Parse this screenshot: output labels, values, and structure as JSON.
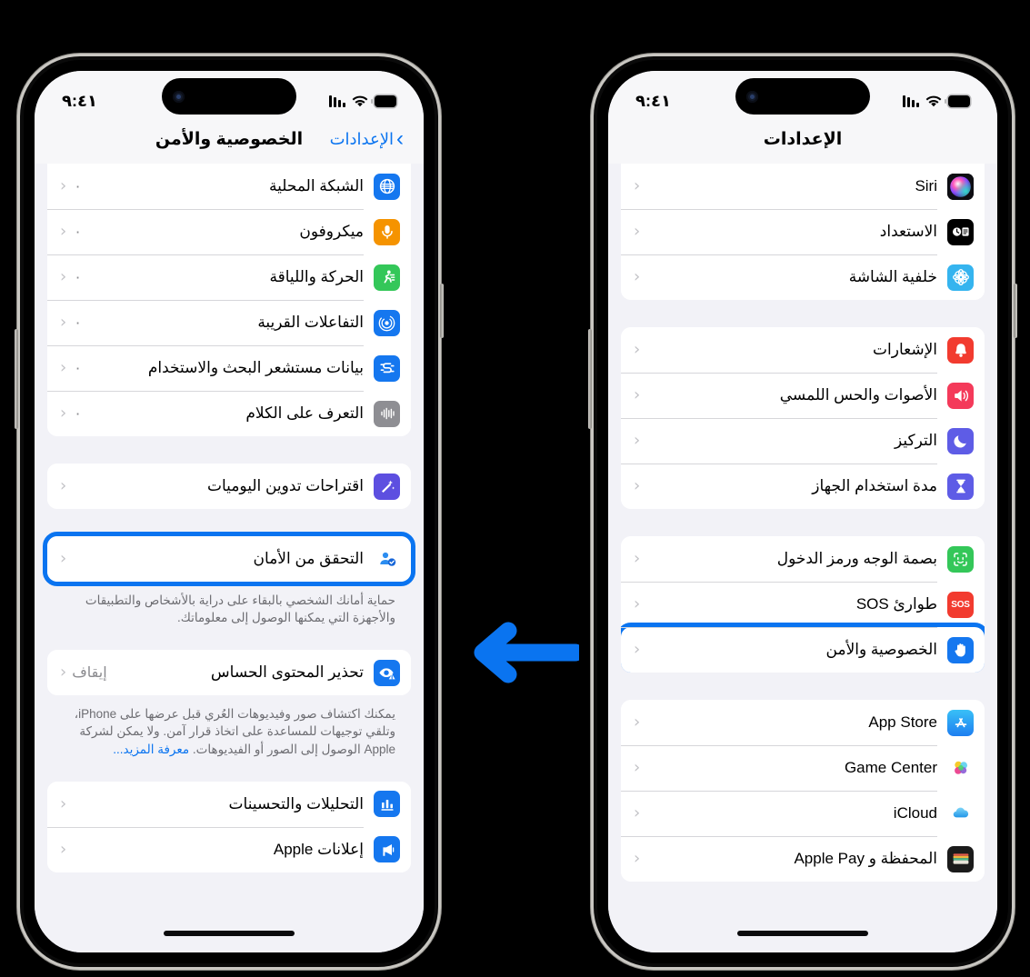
{
  "meta": {
    "background_color": "#000000",
    "accent_color": "#0a74f0",
    "highlight_color": "#0a74f0"
  },
  "arrow": {
    "name": "left-pointing-arrow",
    "color": "#0a74f0",
    "direction": "left"
  },
  "phones": [
    {
      "id": "left",
      "status_bar": {
        "time": "٩:٤١",
        "icons": [
          "battery-icon",
          "wifi-icon",
          "cellular-signal-icon"
        ]
      },
      "nav": {
        "back_label": "الإعدادات",
        "title": "الخصوصية والأمن",
        "back_icon": "chevron-right-icon"
      },
      "sections": [
        {
          "id": "permissions",
          "flush_top": true,
          "rows": [
            {
              "label": "الشبكة المحلية",
              "icon": "globe-icon",
              "icon_color": "#1577ef",
              "value": "٠",
              "chevron": true
            },
            {
              "label": "ميكروفون",
              "icon": "microphone-icon",
              "icon_color": "#f59300",
              "value": "٠",
              "chevron": true
            },
            {
              "label": "الحركة واللياقة",
              "icon": "motion-fitness-icon",
              "icon_color": "#34c759",
              "value": "٠",
              "chevron": true
            },
            {
              "label": "التفاعلات القريبة",
              "icon": "nearby-interactions-icon",
              "icon_color": "#1577ef",
              "value": "٠",
              "chevron": true
            },
            {
              "label": "بيانات مستشعر البحث والاستخدام",
              "icon": "research-sensor-icon",
              "icon_color": "#1577ef",
              "value": "٠",
              "chevron": true
            },
            {
              "label": "التعرف على الكلام",
              "icon": "speech-recognition-icon",
              "icon_color": "#8e8e93",
              "value": "٠",
              "chevron": true
            }
          ]
        },
        {
          "id": "journaling",
          "rows": [
            {
              "label": "اقتراحات تدوين اليوميات",
              "icon": "journaling-suggestions-icon",
              "icon_color": "#5d4fe0",
              "chevron": true
            }
          ]
        },
        {
          "id": "safety-check",
          "highlighted": true,
          "rows": [
            {
              "label": "التحقق من الأمان",
              "icon": "safety-check-icon",
              "icon_color": "#ffffff",
              "chevron": true
            }
          ],
          "footnote": "حماية أمانك الشخصي بالبقاء على دراية بالأشخاص والتطبيقات والأجهزة التي يمكنها الوصول إلى معلوماتك."
        },
        {
          "id": "sensitive-content",
          "rows": [
            {
              "label": "تحذير المحتوى الحساس",
              "icon": "sensitive-content-icon",
              "icon_color": "#1577ef",
              "value": "إيقاف",
              "chevron": true
            }
          ],
          "footnote": "يمكنك اكتشاف صور وفيديوهات العُري قبل عرضها على iPhone، وتلقي توجيهات للمساعدة على اتخاذ قرار آمن. ولا يمكن لشركة Apple الوصول إلى الصور أو الفيديوهات.",
          "footnote_link": "معرفة المزيد..."
        },
        {
          "id": "analytics",
          "rows": [
            {
              "label": "التحليلات والتحسينات",
              "icon": "analytics-icon",
              "icon_color": "#1577ef",
              "chevron": true
            },
            {
              "label": "إعلانات Apple",
              "icon": "apple-advertising-icon",
              "icon_color": "#1577ef",
              "chevron": true
            }
          ]
        }
      ]
    },
    {
      "id": "right",
      "status_bar": {
        "time": "٩:٤١",
        "icons": [
          "battery-icon",
          "wifi-icon",
          "cellular-signal-icon"
        ]
      },
      "nav": {
        "back_label": "",
        "title": "الإعدادات",
        "back_icon": ""
      },
      "sections": [
        {
          "id": "siri-group",
          "flush_top": true,
          "rows": [
            {
              "label": "Siri",
              "icon": "siri-icon",
              "icon_color": "#111111",
              "chevron": true
            },
            {
              "label": "الاستعداد",
              "icon": "standby-icon",
              "icon_color": "#000000",
              "chevron": true
            },
            {
              "label": "خلفية الشاشة",
              "icon": "wallpaper-icon",
              "icon_color": "#35b4ef",
              "chevron": true
            }
          ]
        },
        {
          "id": "notifications-group",
          "rows": [
            {
              "label": "الإشعارات",
              "icon": "notifications-bell-icon",
              "icon_color": "#f23b2f",
              "chevron": true
            },
            {
              "label": "الأصوات والحس اللمسي",
              "icon": "sounds-haptics-icon",
              "icon_color": "#f43a5a",
              "chevron": true
            },
            {
              "label": "التركيز",
              "icon": "focus-moon-icon",
              "icon_color": "#5e5ce6",
              "chevron": true
            },
            {
              "label": "مدة استخدام الجهاز",
              "icon": "screen-time-hourglass-icon",
              "icon_color": "#5e5ce6",
              "chevron": true
            }
          ]
        },
        {
          "id": "security-group",
          "rows": [
            {
              "label": "بصمة الوجه ورمز الدخول",
              "icon": "face-id-icon",
              "icon_color": "#34c759",
              "chevron": true
            },
            {
              "label": "طوارئ SOS",
              "icon": "sos-icon",
              "icon_color": "#f23b2f",
              "chevron": true
            },
            {
              "label": "الخصوصية والأمن",
              "icon": "privacy-hand-icon",
              "icon_color": "#1577ef",
              "chevron": true,
              "highlighted": true
            }
          ]
        },
        {
          "id": "services-group",
          "rows": [
            {
              "label": "App Store",
              "icon": "app-store-icon",
              "icon_color": "#2aa3f5",
              "chevron": true
            },
            {
              "label": "Game Center",
              "icon": "game-center-icon",
              "icon_color": "#ffffff",
              "chevron": true
            },
            {
              "label": "iCloud",
              "icon": "icloud-icon",
              "icon_color": "#ffffff",
              "chevron": true
            },
            {
              "label": "المحفظة و Apple Pay",
              "icon": "wallet-icon",
              "icon_color": "#1b1b1b",
              "chevron": true
            }
          ]
        }
      ]
    }
  ]
}
